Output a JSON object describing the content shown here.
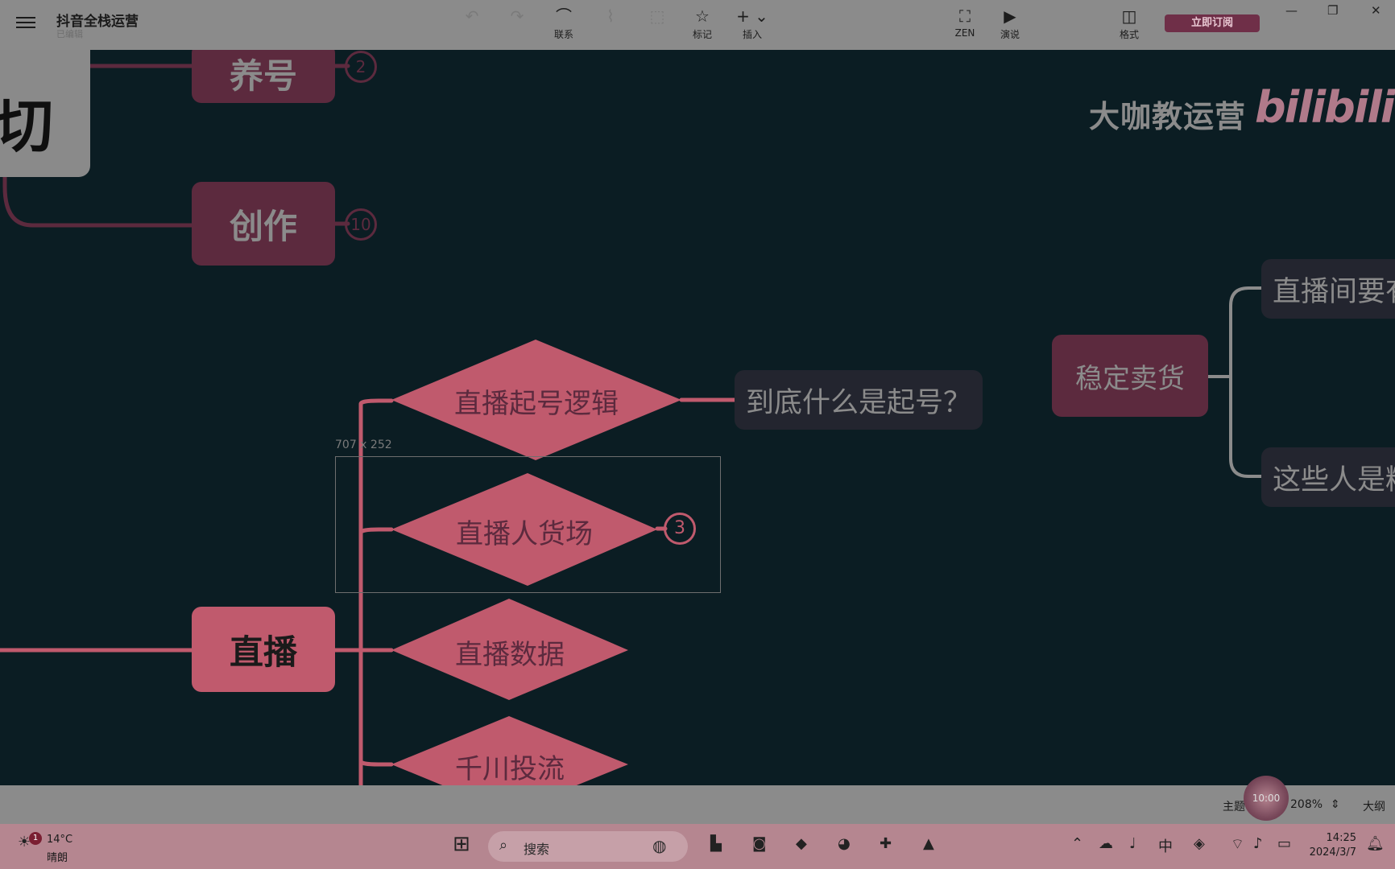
{
  "toolbar": {
    "title": "抖音全栈运营",
    "subtitle": "已编辑",
    "tools": {
      "relation": "联系",
      "mark": "标记",
      "insert": "插入",
      "zen": "ZEN",
      "present": "演说",
      "format": "格式"
    },
    "subscribe": "立即订阅"
  },
  "canvas": {
    "watermark": "大咖教运营",
    "bili_logo": "bilibili",
    "root_char": "切",
    "topics": {
      "raise_account": "养号",
      "raise_count": "2",
      "create": "创作",
      "create_count": "10",
      "live": "直播",
      "stable_sales": "稳定卖货"
    },
    "diamonds": {
      "logic": "直播起号逻辑",
      "people_goods": "直播人货场",
      "people_goods_count": "3",
      "data": "直播数据",
      "qianchuan": "千川投流"
    },
    "subtopics": {
      "what_is": "到底什么是起号？",
      "live_room": "直播间要有",
      "these_people": "这些人是精"
    },
    "selection_size": "707 x 252"
  },
  "statusbar": {
    "theme": "主题",
    "zoom": "208%",
    "outline": "大纲",
    "timer": "10:00"
  },
  "taskbar": {
    "temperature": "14°C",
    "weather": "晴朗",
    "search_placeholder": "搜索",
    "time": "14:25",
    "date": "2024/3/7",
    "notification_count": "1"
  }
}
